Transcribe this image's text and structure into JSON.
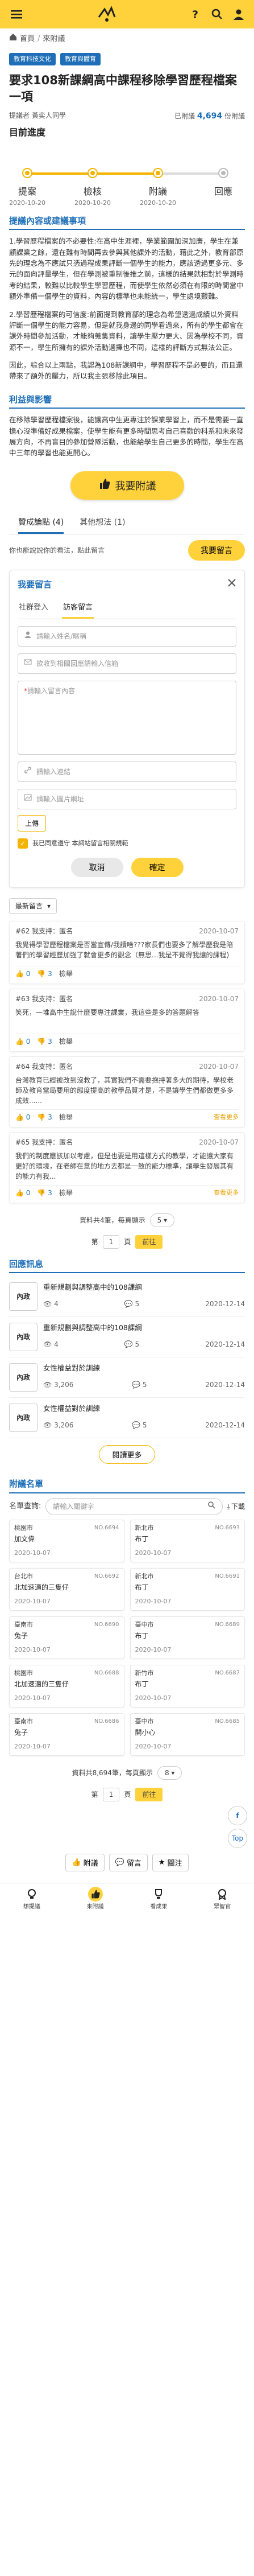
{
  "breadcrumb": {
    "home": "首頁",
    "sep": "/",
    "current": "來附議"
  },
  "tags": [
    "教育科技文化",
    "教育與體育"
  ],
  "title": "要求108新課綱高中課程移除學習歷程檔案一項",
  "proposer_label": "提議者",
  "proposer": "黃奕人同學",
  "count_prefix": "已附議",
  "count": "4,694",
  "count_unit": "份附議",
  "progress": {
    "heading": "目前進度",
    "fill_fraction": 0.66,
    "steps": [
      {
        "label": "提案",
        "date": "2020-10-20",
        "active": true
      },
      {
        "label": "檢核",
        "date": "2020-10-20",
        "active": true
      },
      {
        "label": "附議",
        "date": "2020-10-20",
        "active": true
      },
      {
        "label": "回應",
        "date": "",
        "active": false
      }
    ]
  },
  "sections": {
    "content_heading": "提議內容或建議事項",
    "content_p1": "1.學習歷程檔案的不必要性:在高中生涯裡，學業範圍加深加廣，學生在兼顧課業之餘，還在難有時間再去參與其他課外的活動，藉此之外，教育部原先的理念為不應試只憑過程成果評斷一個學生的能力，應該透過更多元、多元的面向評量學生，但在學測被重制後推之前，這樣的結果就相對於學測時考的結果，較難以比較學生學習歷程，而使學生依然必須在有限的時間當中額外準備一個學生的資料，內容的標準也未能統一，學生處境艱難。",
    "content_p2": "2.學習歷程檔案的可信度:前面提到教育部的理念為希望透過成績以外資料評斷一個學生的能力容易，但是就我身邊的同學看過來，所有的學生都會在課外時間參加活動，才能夠蒐集資料，讓學生壓力更大、因為學校不同，資源不一，學生所擁有的課外活動選擇也不同，這樣的評斷方式無法公正。",
    "content_p3": "因此，綜合以上兩點，我認為108新課綱中，學習歷程不是必要的，而且還帶來了額外的壓力，所以我主張移除此項目。",
    "benefit_heading": "利益與影響",
    "benefit_p": "在移除學習歷程檔案後，能讓高中生更專注於課業學習上，而不是需要一直擔心沒準備好成果檔案，使學生能有更多時間思考自己喜歡的科系和未來發展方向，不再盲目的參加營隊活動，也能給學生自己更多的時間，學生在高中三年的學習也能更開心。"
  },
  "endorse_button": "我要附議",
  "tabs": [
    {
      "label": "贊成論點",
      "count": "(4)"
    },
    {
      "label": "其他想法",
      "count": "(1)"
    }
  ],
  "prompt": "你也能說說你的看法，點此留言",
  "leave_msg_button": "我要留言",
  "form": {
    "title": "我要留言",
    "tabs": [
      "社群登入",
      "訪客留言"
    ],
    "name_ph": "請輸入姓名/暱稱",
    "email_ph": "欲收到相關回應請輸入信箱",
    "content_ph": "請輸入留言內容",
    "content_req": "*",
    "link_ph": "請輸入連結",
    "image_ph": "請輸入圖片網址",
    "upload": "上傳",
    "agree": "我已同意遵守 本網站留言相關規範",
    "cancel": "取消",
    "ok": "確定"
  },
  "sort": "最新留言",
  "comments": [
    {
      "id": "#62",
      "label": "我支持",
      "name": "匿名",
      "date": "2020-10-07",
      "body": "我覺得學習歷程檔案是否當宣傳/我讀啥???家長們也要多了解學歷我是陪著們的學習經歷加強了就會更多的觀念（無思...我是不覺得我讓的課程)",
      "up": "0",
      "down": "3",
      "reply": "檢舉",
      "more": ""
    },
    {
      "id": "#63",
      "label": "我支持",
      "name": "匿名",
      "date": "2020-10-07",
      "body": "笑死，一堆高中生說什麼要專注課業，我這些是多的答題解答",
      "up": "0",
      "down": "3",
      "reply": "檢舉",
      "more": ""
    },
    {
      "id": "#64",
      "label": "我支持",
      "name": "匿名",
      "date": "2020-10-07",
      "body": "台灣教育已經被改到沒救了，其實我們不需要抱持著多大的期待，學校老師及教育當局要用的態度提高的教學品質才是，不是讓學生們都做更多多成效......",
      "up": "0",
      "down": "3",
      "reply": "檢舉",
      "more": "查看更多"
    },
    {
      "id": "#65",
      "label": "我支持",
      "name": "匿名",
      "date": "2020-10-07",
      "body": "我們的制度應該加以考慮，但是也要是用這樣方式的教學，才能讓大家有更好的環境，在老師在意的地方去都是一致的能力標準，讓學生發展其有的能力有我...",
      "up": "0",
      "down": "3",
      "reply": "檢舉",
      "more": "查看更多"
    }
  ],
  "pager1": {
    "total": "資料共4筆，每頁顯示",
    "per": "5",
    "page_label": "第",
    "page": "1",
    "page_unit": "頁",
    "go": "前往"
  },
  "reply_heading": "回應訊息",
  "replies": [
    {
      "thumb": "內政",
      "title": "重新規劃與調整高中的108課綱",
      "views": "4",
      "comments": "5",
      "date": "2020-12-14"
    },
    {
      "thumb": "內政",
      "title": "重新規劃與調整高中的108課綱",
      "views": "4",
      "comments": "5",
      "date": "2020-12-14"
    },
    {
      "thumb": "內政",
      "title": "女性權益對於訓練",
      "views": "3,206",
      "comments": "5",
      "date": "2020-12-14"
    },
    {
      "thumb": "內政",
      "title": "女性權益對於訓練",
      "views": "3,206",
      "comments": "5",
      "date": "2020-12-14"
    }
  ],
  "more_button": "閱讀更多",
  "roster": {
    "heading": "附議名單",
    "search_label": "名單查詢:",
    "search_ph": "請輸入關鍵字",
    "download": "下載",
    "cards": [
      {
        "city": "桃園市",
        "no": "NO.6694",
        "name": "加文偉",
        "date": "2020-10-07"
      },
      {
        "city": "新北市",
        "no": "NO.6693",
        "name": "布丁",
        "date": "2020-10-07"
      },
      {
        "city": "台北市",
        "no": "NO.6692",
        "name": "北加速適的三隻仔",
        "date": "2020-10-07"
      },
      {
        "city": "新北市",
        "no": "NO.6691",
        "name": "布丁",
        "date": "2020-10-07"
      },
      {
        "city": "臺南市",
        "no": "NO.6690",
        "name": "兔子",
        "date": "2020-10-07"
      },
      {
        "city": "臺中市",
        "no": "NO.6689",
        "name": "布丁",
        "date": "2020-10-07"
      },
      {
        "city": "桃園市",
        "no": "NO.6688",
        "name": "北加速適的三隻仔",
        "date": "2020-10-07"
      },
      {
        "city": "新竹市",
        "no": "NO.6687",
        "name": "布丁",
        "date": "2020-10-07"
      },
      {
        "city": "臺南市",
        "no": "NO.6686",
        "name": "兔子",
        "date": "2020-10-07"
      },
      {
        "city": "臺中市",
        "no": "NO.6685",
        "name": "開小心",
        "date": "2020-10-07"
      }
    ]
  },
  "pager2": {
    "total": "資料共8,694筆，每頁顯示",
    "per": "8",
    "page_label": "第",
    "page": "1",
    "page_unit": "頁",
    "go": "前往"
  },
  "bottom_actions": [
    "附議",
    "留言",
    "關注"
  ],
  "floats": [
    "Top"
  ],
  "nav": [
    {
      "label": "想提議",
      "icon": "bulb-icon"
    },
    {
      "label": "來附議",
      "icon": "thumb-icon"
    },
    {
      "label": "看成果",
      "icon": "trophy-icon"
    },
    {
      "label": "眾智官",
      "icon": "badge-icon"
    }
  ],
  "colors": {
    "primary": "#ffd23c",
    "accent": "#1e6fb8",
    "highlight": "#f4b400"
  }
}
